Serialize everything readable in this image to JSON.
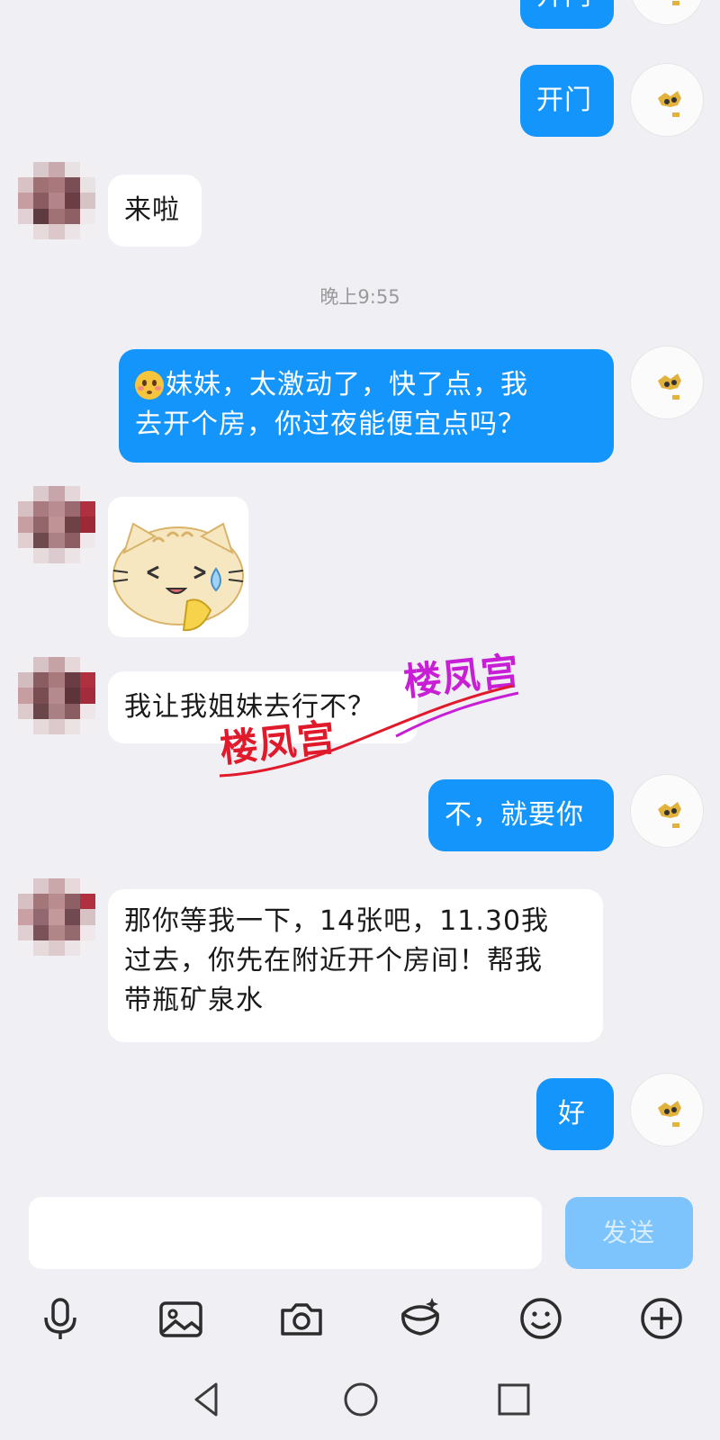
{
  "chat": {
    "top_partial_label": "开门",
    "messages": [
      {
        "from": "me",
        "text": "开门"
      },
      {
        "from": "her",
        "text": "来啦"
      },
      {
        "from": "system",
        "text": "晚上9:55"
      },
      {
        "from": "me",
        "line1": "妹妹，太激动了，快了点，我",
        "line2": "去开个房，你过夜能便宜点吗？"
      },
      {
        "from": "her",
        "type": "sticker",
        "icon": "crying-cat-sticker"
      },
      {
        "from": "her",
        "text": "我让我姐妹去行不？"
      },
      {
        "from": "me",
        "text": "不，就要你"
      },
      {
        "from": "her",
        "line1": "那你等我一下，14张吧，11.30我",
        "line2": "过去，你先在附近开个房间！帮我",
        "line3": "带瓶矿泉水"
      },
      {
        "from": "me",
        "text": "好"
      }
    ]
  },
  "watermark": {
    "text_red": "楼凤宫",
    "text_purple": "楼凤宫",
    "color_red": "#e11a2b",
    "color_purple": "#c81fd6"
  },
  "input": {
    "placeholder": "",
    "send_label": "发送"
  },
  "toolbar": {
    "icons": [
      "microphone-icon",
      "image-icon",
      "camera-icon",
      "red-packet-icon",
      "emoji-icon",
      "plus-icon"
    ]
  },
  "navbar": {
    "icons": [
      "back-icon",
      "home-icon",
      "recents-icon"
    ]
  },
  "colors": {
    "accent": "#1495fb",
    "background": "#efeff4",
    "send_disabled": "#7cc4fb"
  }
}
